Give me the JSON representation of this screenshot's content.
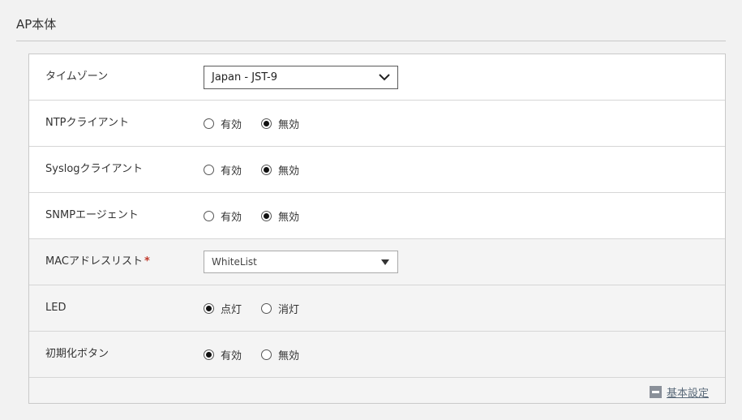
{
  "section": {
    "title": "AP本体"
  },
  "rows": {
    "timezone": {
      "label": "タイムゾーン",
      "value": "Japan - JST-9"
    },
    "ntp": {
      "label": "NTPクライアント",
      "opt1": "有効",
      "opt2": "無効",
      "selected": "無効"
    },
    "syslog": {
      "label": "Syslogクライアント",
      "opt1": "有効",
      "opt2": "無効",
      "selected": "無効"
    },
    "snmp": {
      "label": "SNMPエージェント",
      "opt1": "有効",
      "opt2": "無効",
      "selected": "無効"
    },
    "mac": {
      "label": "MACアドレスリスト",
      "required_mark": "*",
      "value": "WhiteList"
    },
    "led": {
      "label": "LED",
      "opt1": "点灯",
      "opt2": "消灯",
      "selected": "点灯"
    },
    "init_button": {
      "label": "初期化ボタン",
      "opt1": "有効",
      "opt2": "無効",
      "selected": "有効"
    }
  },
  "footer": {
    "collapse_label": "基本設定"
  }
}
